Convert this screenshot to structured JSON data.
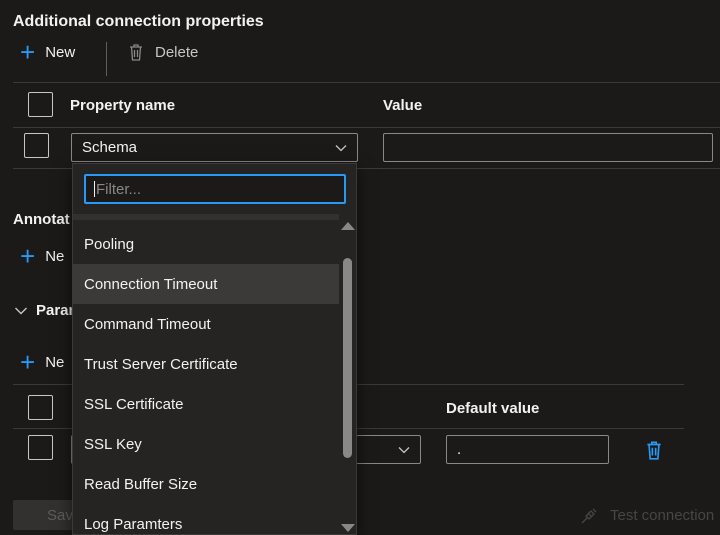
{
  "title": "Additional connection properties",
  "toolbar": {
    "new_label": "New",
    "delete_label": "Delete"
  },
  "props_table": {
    "col_property": "Property name",
    "col_value": "Value",
    "row": {
      "property": "Schema",
      "value": ""
    }
  },
  "annotations": {
    "title": "Annotat",
    "new_label": "Ne"
  },
  "parameters": {
    "title": "Param",
    "new_label": "Ne",
    "col_default": "Default value",
    "row": {
      "default_value": "."
    }
  },
  "dropdown": {
    "filter_placeholder": "Filter...",
    "items": [
      "Pooling",
      "Connection Timeout",
      "Command Timeout",
      "Trust Server Certificate",
      "SSL Certificate",
      "SSL Key",
      "Read Buffer Size",
      "Log Paramters"
    ],
    "hovered_index": 1
  },
  "footer": {
    "save_label": "Sav",
    "test_connection_label": "Test connection"
  },
  "colors": {
    "accent": "#2899f5",
    "background": "#1b1a19",
    "text": "#f3f2f1"
  }
}
